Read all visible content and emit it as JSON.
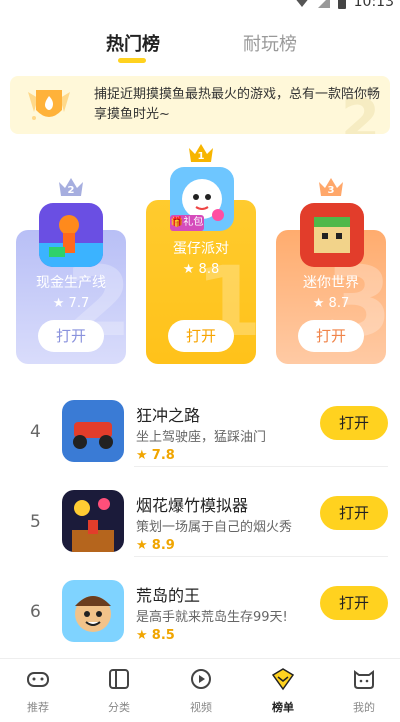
{
  "status_bar": {
    "time": "10:13"
  },
  "tabs": [
    {
      "label": "热门榜",
      "active": true
    },
    {
      "label": "耐玩榜",
      "active": false
    }
  ],
  "banner": {
    "text": "捕捉近期摸摸鱼最热最火的游戏，总有一款陪你畅享摸鱼时光~"
  },
  "podium": [
    {
      "rank": "2",
      "name": "现金生产线",
      "rating": "7.7",
      "button": "打开"
    },
    {
      "rank": "1",
      "name": "蛋仔派对",
      "rating": "8.8",
      "button": "打开",
      "tag": "礼包"
    },
    {
      "rank": "3",
      "name": "迷你世界",
      "rating": "8.7",
      "button": "打开"
    }
  ],
  "list": [
    {
      "rank": "4",
      "name": "狂冲之路",
      "desc": "坐上驾驶座，猛踩油门",
      "rating": "7.8",
      "button": "打开"
    },
    {
      "rank": "5",
      "name": "烟花爆竹模拟器",
      "desc": "策划一场属于自己的烟火秀",
      "rating": "8.9",
      "button": "打开"
    },
    {
      "rank": "6",
      "name": "荒岛的王",
      "desc": "是高手就来荒岛生存99天!",
      "rating": "8.5",
      "button": "打开"
    }
  ],
  "nav": [
    {
      "label": "推荐",
      "icon": "gamepad-icon"
    },
    {
      "label": "分类",
      "icon": "category-icon"
    },
    {
      "label": "视频",
      "icon": "play-icon"
    },
    {
      "label": "榜单",
      "icon": "ranking-icon",
      "active": true
    },
    {
      "label": "我的",
      "icon": "cat-face-icon"
    }
  ],
  "colors": {
    "accent": "#ffd21f",
    "rating": "#f0a500"
  }
}
